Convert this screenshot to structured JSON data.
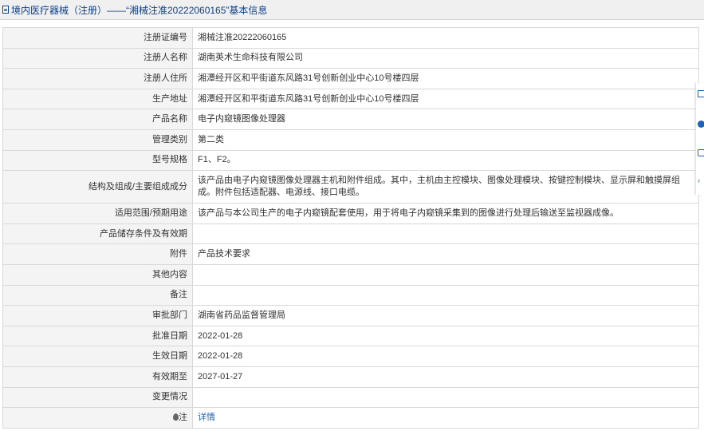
{
  "header": {
    "title": "境内医疗器械（注册）——“湘械注准20222060165”基本信息"
  },
  "rows": [
    {
      "label": "注册证编号",
      "value": "湘械注准20222060165"
    },
    {
      "label": "注册人名称",
      "value": "湖南英术生命科技有限公司"
    },
    {
      "label": "注册人住所",
      "value": "湘潭经开区和平街道东风路31号创新创业中心10号楼四层"
    },
    {
      "label": "生产地址",
      "value": "湘潭经开区和平街道东风路31号创新创业中心10号楼四层"
    },
    {
      "label": "产品名称",
      "value": "电子内窥镜图像处理器"
    },
    {
      "label": "管理类别",
      "value": "第二类"
    },
    {
      "label": "型号规格",
      "value": "F1、F2。"
    },
    {
      "label": "结构及组成/主要组成成分",
      "value": "该产品由电子内窥镜图像处理器主机和附件组成。其中，主机由主控模块、图像处理模块、按键控制模块、显示屏和触摸屏组成。附件包括适配器、电源线、接口电缆。"
    },
    {
      "label": "适用范围/预期用途",
      "value": "该产品与本公司生产的电子内窥镜配套使用，用于将电子内窥镜采集到的图像进行处理后输送至监视器成像。"
    },
    {
      "label": "产品储存条件及有效期",
      "value": ""
    },
    {
      "label": "附件",
      "value": "产品技术要求"
    },
    {
      "label": "其他内容",
      "value": ""
    },
    {
      "label": "备注",
      "value": ""
    },
    {
      "label": "审批部门",
      "value": "湖南省药品监督管理局"
    },
    {
      "label": "批准日期",
      "value": "2022-01-28"
    },
    {
      "label": "生效日期",
      "value": "2022-01-28"
    },
    {
      "label": "有效期至",
      "value": "2027-01-27"
    },
    {
      "label": "变更情况",
      "value": ""
    }
  ],
  "note": {
    "label": "注",
    "link_text": "详情"
  },
  "colors": {
    "title_text": "#0f3f88",
    "link": "#1e62b8",
    "label_bg": "#f4f4f4",
    "border": "#d9d9d9"
  },
  "icons": [
    "document-icon",
    "note-icon",
    "edit-icon",
    "help-icon",
    "share-icon",
    "expand-icon"
  ]
}
